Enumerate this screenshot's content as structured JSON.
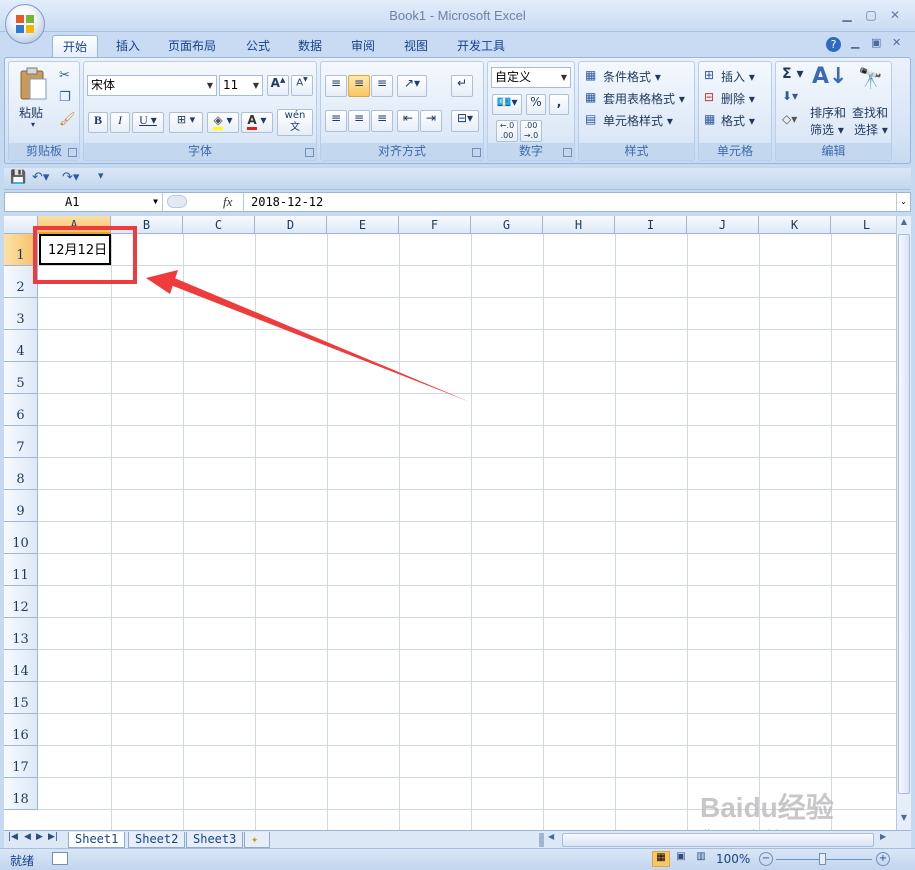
{
  "window": {
    "title": "Book1 - Microsoft Excel"
  },
  "tabs": [
    "开始",
    "插入",
    "页面布局",
    "公式",
    "数据",
    "审阅",
    "视图",
    "开发工具"
  ],
  "ribbon": {
    "clipboard": {
      "paste": "粘贴",
      "label": "剪贴板"
    },
    "font": {
      "name": "宋体",
      "size": "11",
      "label": "字体",
      "phonetic": "wén\n文"
    },
    "alignment": {
      "label": "对齐方式"
    },
    "number": {
      "format": "自定义",
      "label": "数字",
      "percent": "%",
      "comma": ",",
      "inc_decimal": "←.0\n.00",
      "dec_decimal": ".00\n→.0"
    },
    "styles": {
      "conditional": "条件格式",
      "table": "套用表格格式",
      "cell": "单元格样式",
      "label": "样式"
    },
    "cells": {
      "insert": "插入",
      "delete": "删除",
      "format": "格式",
      "label": "单元格"
    },
    "editing": {
      "sort": "排序和",
      "sort2": "筛选",
      "find": "查找和",
      "find2": "选择",
      "label": "编辑"
    }
  },
  "formula": {
    "name_box": "A1",
    "fx": "fx",
    "value": "2018-12-12"
  },
  "columns": [
    "A",
    "B",
    "C",
    "D",
    "E",
    "F",
    "G",
    "H",
    "I",
    "J",
    "K",
    "L"
  ],
  "rows": [
    "1",
    "2",
    "3",
    "4",
    "5",
    "6",
    "7",
    "8",
    "9",
    "10",
    "11",
    "12",
    "13",
    "14",
    "15",
    "16",
    "17",
    "18"
  ],
  "cell_a1": "12月12日",
  "sheets": [
    "Sheet1",
    "Sheet2",
    "Sheet3"
  ],
  "status": {
    "ready": "就绪",
    "zoom": "100%"
  },
  "watermark": {
    "brand": "Baidu经验",
    "url": "jingyan.baidu.com"
  },
  "colors": {
    "annotation": "#ee3b3b",
    "ribbon_text": "#15428b"
  }
}
